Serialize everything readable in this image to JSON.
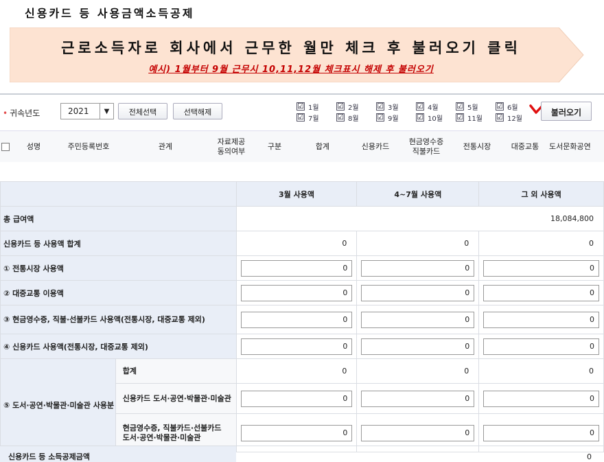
{
  "page": {
    "heading": "신용카드 등 사용금액소득공제"
  },
  "banner": {
    "main": "근로소득자로 회사에서 근무한 월만 체크 후 불러오기 클릭",
    "sub": "예시) 1월부터 9월 근무시 10,11,12월 체크표시 해제 후 불러오기",
    "color": "#fde3d2"
  },
  "filter": {
    "year_label": "귀속년도",
    "year_value": "2021",
    "select_all": "전체선택",
    "deselect": "선택해제",
    "months": [
      "1월",
      "2월",
      "3월",
      "4월",
      "5월",
      "6월",
      "7월",
      "8월",
      "9월",
      "10월",
      "11월",
      "12월"
    ],
    "load_button": "불러오기",
    "check_glyph": "☑"
  },
  "person_table": {
    "columns": [
      "성명",
      "주민등록번호",
      "관계",
      "자료제공\n동의여부",
      "구분",
      "합계",
      "신용카드",
      "현금영수증\n직불카드",
      "전통시장",
      "대중교통",
      "도서문화공연"
    ]
  },
  "amount_table": {
    "col_headers": [
      "3월 사용액",
      "4~7월 사용액",
      "그 외 사용액"
    ],
    "rows": {
      "total_salary": {
        "label": "총 급여액",
        "value": "18,084,800"
      },
      "card_total": {
        "label": "신용카드 등 사용액 합계",
        "values": [
          "0",
          "0",
          "0"
        ]
      },
      "traditional_market": {
        "label": "① 전통시장 사용액",
        "values": [
          "0",
          "0",
          "0"
        ]
      },
      "public_transport": {
        "label": "② 대중교통 이용액",
        "values": [
          "0",
          "0",
          "0"
        ]
      },
      "cash_receipt": {
        "label": "③ 현금영수증, 직불·선불카드 사용액(전통시장, 대중교통 제외)",
        "values": [
          "0",
          "0",
          "0"
        ]
      },
      "credit_card": {
        "label": "④ 신용카드 사용액(전통시장, 대중교통 제외)",
        "values": [
          "0",
          "0",
          "0"
        ]
      },
      "culture": {
        "label": "⑤ 도서·공연·박물관·미술관 사용분",
        "sub_total": {
          "label": "합계",
          "values": [
            "0",
            "0",
            "0"
          ]
        },
        "sub_credit": {
          "label": "신용카드 도서·공연·박물관·미술관",
          "values": [
            "0",
            "0",
            "0"
          ]
        },
        "sub_cash": {
          "label": "현금영수증, 직불카드·선불카드\n도서·공연·박물관·미술관",
          "values": [
            "0",
            "0",
            "0"
          ]
        }
      }
    },
    "deduction": {
      "label": "신용카드 등 소득공제금액",
      "value": "0"
    }
  }
}
